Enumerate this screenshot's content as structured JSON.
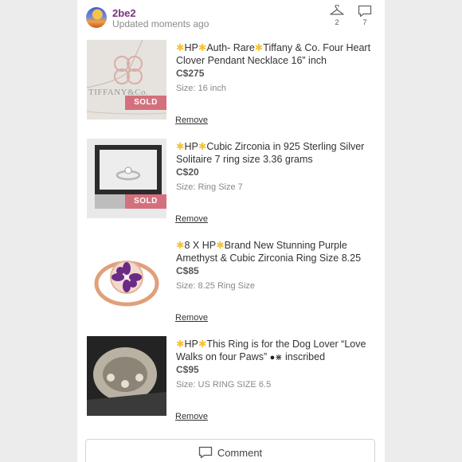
{
  "header": {
    "username": "2be2",
    "updated": "Updated moments ago",
    "likes_icon": "hanger-icon",
    "likes_count": "2",
    "comments_icon": "comment-bubble-icon",
    "comments_count": "7"
  },
  "items": [
    {
      "title_pre": "HP",
      "title_mid": "Auth- Rare",
      "title_post": "Tiffany & Co. Four Heart Clover Pendant Necklace 16” inch",
      "price": "C$275",
      "size": "Size: 16 inch",
      "badge": "SOLD",
      "image_text": "TIFFANY&Co.",
      "remove": "Remove"
    },
    {
      "title_pre": "HP",
      "title_post": "Cubic Zirconia in 925 Sterling Silver Solitaire 7 ring size 3.36 grams",
      "price": "C$20",
      "size": "Size: Ring Size 7",
      "badge": "SOLD",
      "remove": "Remove"
    },
    {
      "title_pre": "8 X HP",
      "title_post": "Brand New Stunning Purple Amethyst & Cubic Zirconia Ring Size 8.25",
      "price": "C$85",
      "size": "Size: 8.25 Ring Size",
      "remove": "Remove"
    },
    {
      "title_pre": "HP",
      "title_post": "This Ring is for the Dog Lover “Love Walks on four Paws”",
      "title_tail": "inscribed",
      "price": "C$95",
      "size": "Size: US RING SIZE 6.5",
      "remove": "Remove"
    }
  ],
  "comment_button": {
    "label": "Comment",
    "icon": "comment-icon"
  }
}
